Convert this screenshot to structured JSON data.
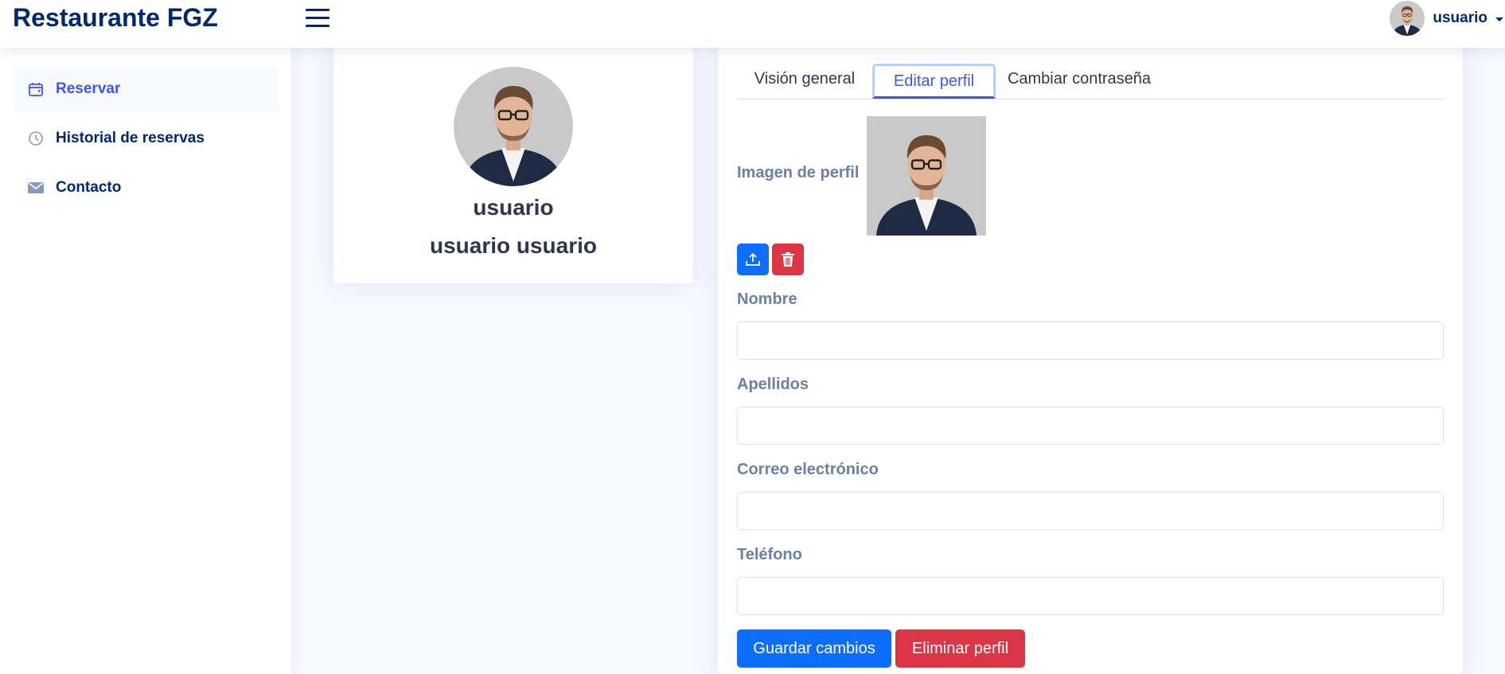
{
  "header": {
    "brand": "Restaurante FGZ",
    "menu_icon": "hamburger-icon",
    "user_name": "usuario"
  },
  "sidebar": {
    "items": [
      {
        "label": "Reservar",
        "icon": "calendar-icon",
        "active": true
      },
      {
        "label": "Historial de reservas",
        "icon": "clock-icon",
        "active": false
      },
      {
        "label": "Contacto",
        "icon": "envelope-icon",
        "active": false
      }
    ]
  },
  "profile": {
    "username": "usuario",
    "full_name": "usuario usuario"
  },
  "tabs": [
    {
      "label": "Visión general",
      "active": false
    },
    {
      "label": "Editar perfil",
      "active": true
    },
    {
      "label": "Cambiar contraseña",
      "active": false
    }
  ],
  "form": {
    "image_label": "Imagen de perfil",
    "upload_icon": "upload-icon",
    "delete_icon": "trash-icon",
    "fields": [
      {
        "label": "Nombre",
        "value": ""
      },
      {
        "label": "Apellidos",
        "value": ""
      },
      {
        "label": "Correo electrónico",
        "value": ""
      },
      {
        "label": "Teléfono",
        "value": ""
      }
    ],
    "save_label": "Guardar cambios",
    "delete_label": "Eliminar perfil"
  },
  "colors": {
    "accent": "#4154f1",
    "brand_text": "#012970",
    "primary_button": "#0d6efd",
    "danger_button": "#dc3545",
    "page_background": "#f6f9ff"
  }
}
